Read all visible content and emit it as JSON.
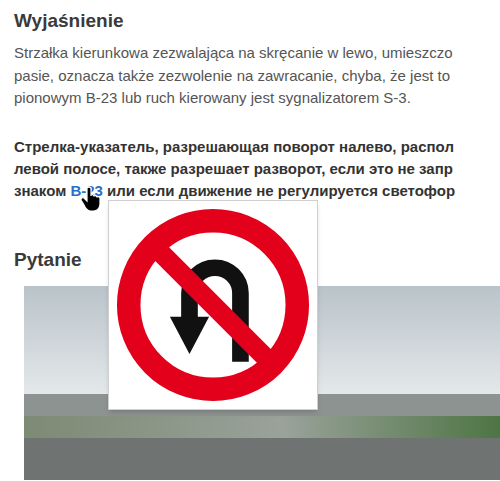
{
  "explanation": {
    "heading": "Wyjaśnienie",
    "polish_lines": [
      "Strzałka kierunkowa zezwalająca na skręcanie w lewo, umieszczo",
      "pasie, oznacza także zezwolenie na zawracanie, chyba, że jest to",
      "pionowym B-23 lub ruch kierowany jest sygnalizatorem S-3."
    ],
    "russian_lines": [
      "Стрелка-указатель, разрешающая поворот налево, распол",
      "левой полосе, также разрешает разворот, если это не запр"
    ],
    "russian_last_line": {
      "before": "знаком ",
      "link": "B-23",
      "after": " или если движение не регулируется светофор"
    }
  },
  "question": {
    "heading": "Pytanie"
  },
  "sign_preview": {
    "open": true
  }
}
